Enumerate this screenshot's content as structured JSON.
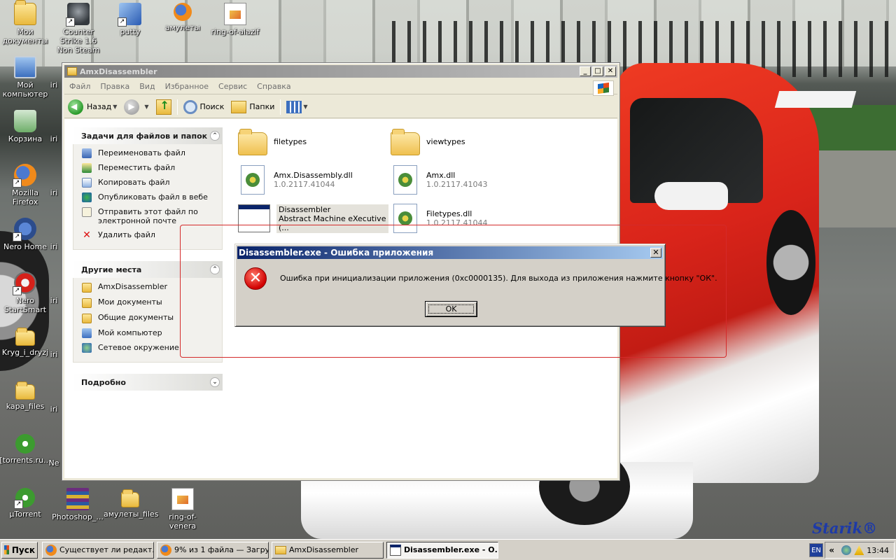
{
  "desktop": {
    "icons": [
      {
        "label": "Мои документы"
      },
      {
        "label": "Counter Strike 1.6 Non Steam"
      },
      {
        "label": "putty"
      },
      {
        "label": "амулеты"
      },
      {
        "label": "ring-of-alazif"
      },
      {
        "label": "Мой компьютер"
      },
      {
        "label": "Корзина"
      },
      {
        "label": "Mozilla Firefox"
      },
      {
        "label": "Nero Home"
      },
      {
        "label": "Nero StartSmart"
      },
      {
        "label": "Kryg_i_dryzj"
      },
      {
        "label": "kapa_files"
      },
      {
        "label": "[torrents.ru..."
      },
      {
        "label": "µTorrent"
      },
      {
        "label": "Photoshop_..."
      },
      {
        "label": "амулеты_files"
      },
      {
        "label": "ring-of-venera"
      }
    ],
    "partial_labels": [
      "iri",
      "iri",
      "iri",
      "iri",
      "iri",
      "iri",
      "iri",
      "Ne"
    ],
    "wallpaper_logo": "Starik®"
  },
  "explorer": {
    "title": "AmxDisassembler",
    "menu": [
      "Файл",
      "Правка",
      "Вид",
      "Избранное",
      "Сервис",
      "Справка"
    ],
    "toolbar": {
      "back": "Назад",
      "search": "Поиск",
      "folders": "Папки"
    },
    "tasks_panel": {
      "title": "Задачи для файлов и папок",
      "items": [
        {
          "label": "Переименовать файл"
        },
        {
          "label": "Переместить файл"
        },
        {
          "label": "Копировать файл"
        },
        {
          "label": "Опубликовать файл в вебе"
        },
        {
          "label": "Отправить этот файл по электронной почте"
        },
        {
          "label": "Удалить файл"
        }
      ]
    },
    "places_panel": {
      "title": "Другие места",
      "items": [
        {
          "label": "AmxDisassembler"
        },
        {
          "label": "Мои документы"
        },
        {
          "label": "Общие документы"
        },
        {
          "label": "Мой компьютер"
        },
        {
          "label": "Сетевое окружение"
        }
      ]
    },
    "details_panel": {
      "title": "Подробно"
    },
    "files": [
      {
        "name": "filetypes",
        "meta": ""
      },
      {
        "name": "viewtypes",
        "meta": ""
      },
      {
        "name": "Amx.Disassembly.dll",
        "meta": "1.0.2117.41044"
      },
      {
        "name": "Amx.dll",
        "meta": "1.0.2117.41043"
      },
      {
        "name": "Disassembler",
        "meta": "Abstract Machine eXecutive (..."
      },
      {
        "name": "Filetypes.dll",
        "meta": "1.0.2117.41044"
      }
    ]
  },
  "dialog": {
    "title": "Disassembler.exe - Ошибка приложения",
    "message": "Ошибка при инициализации приложения (0xc0000135). Для выхода из приложения нажмите кнопку \"ОК\".",
    "ok": "OK"
  },
  "taskbar": {
    "start": "Пуск",
    "buttons": [
      {
        "label": "Существует ли редакт..."
      },
      {
        "label": "9% из 1 файла — Загру..."
      },
      {
        "label": "AmxDisassembler"
      },
      {
        "label": "Disassembler.exe - О..."
      }
    ],
    "lang": "EN",
    "clock": "13:44"
  }
}
